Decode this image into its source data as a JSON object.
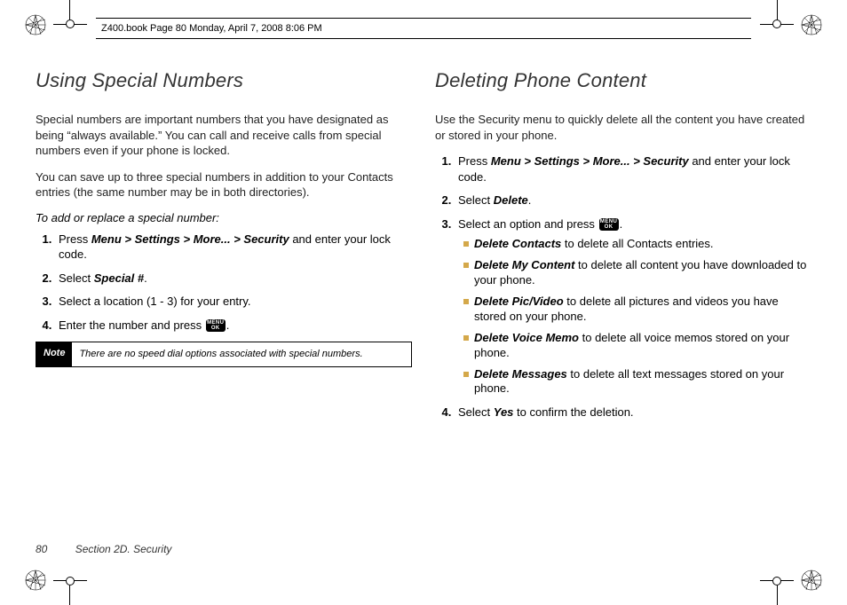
{
  "header": "Z400.book  Page 80  Monday, April 7, 2008  8:06 PM",
  "left": {
    "title": "Using Special Numbers",
    "p1": "Special numbers are important numbers that you have designated as being “always available.” You can call and receive calls from special numbers even if your phone is locked.",
    "p2": "You can save up to three special numbers in addition to your Contacts entries (the same number may be in both directories).",
    "subhead": "To add or replace a special number:",
    "s1a": "Press ",
    "s1b": "Menu > Settings > More... > Security",
    "s1c": " and enter your lock code.",
    "s2a": "Select ",
    "s2b": "Special #",
    "s2c": ".",
    "s3": "Select a location (1 - 3) for your entry.",
    "s4a": "Enter the number and press ",
    "s4b": ".",
    "note_label": "Note",
    "note_text": "There are no speed dial options associated with special numbers."
  },
  "right": {
    "title": "Deleting Phone Content",
    "p1": "Use the Security menu to quickly delete all the content you have created or stored in your phone.",
    "s1a": "Press ",
    "s1b": "Menu > Settings > More... > Security",
    "s1c": " and enter your lock code.",
    "s2a": "Select ",
    "s2b": "Delete",
    "s2c": ".",
    "s3a": "Select an option and press ",
    "s3b": ".",
    "b1a": "Delete Contacts",
    "b1b": " to delete all Contacts entries.",
    "b2a": "Delete My Content",
    "b2b": " to delete all content you have downloaded to your phone.",
    "b3a": "Delete Pic/Video",
    "b3b": " to delete all pictures and videos you have stored on your phone.",
    "b4a": "Delete Voice Memo",
    "b4b": " to delete all voice memos stored on your phone.",
    "b5a": "Delete Messages",
    "b5b": " to delete all text messages stored on your phone.",
    "s4a": "Select ",
    "s4b": "Yes",
    "s4c": " to confirm the deletion."
  },
  "footer": {
    "page": "80",
    "section": "Section 2D. Security"
  },
  "icon": {
    "menu": "MENU",
    "ok": "OK"
  }
}
